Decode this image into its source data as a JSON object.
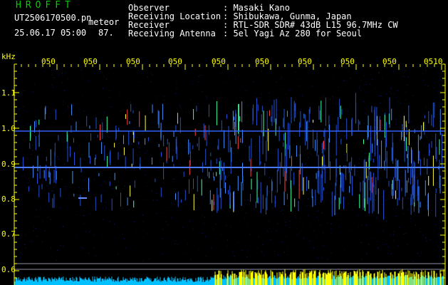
{
  "header": {
    "logo": "HROFFT",
    "filename": "UT2506170500.pn",
    "meteor_label": "meteor",
    "datetime": "25.06.17 05:00",
    "count": "87.",
    "fields": [
      {
        "label": "Observer",
        "value": ": Masaki Kano"
      },
      {
        "label": "Receiving Location",
        "value": ": Shibukawa, Gunma, Japan"
      },
      {
        "label": "Receiver",
        "value": ": RTL-SDR SDR# 43dB L15 96.7MHz CW"
      },
      {
        "label": "Receiving Antenna",
        "value": ": 5el Yagi Az 280 for Seoul"
      }
    ]
  },
  "axis": {
    "y_unit": "kHz",
    "y_ticks": [
      "1.1",
      "1.0",
      "0.9",
      "0.8",
      "0.7",
      "0.6"
    ],
    "x_ticks": [
      "050",
      "050",
      "050",
      "050",
      "050",
      "050",
      "050",
      "050",
      "050",
      "0510"
    ]
  },
  "colors": {
    "background": "#000000",
    "text": "#ffffff",
    "axis": "#ffff00",
    "logo": "#00d000",
    "carrier": "#3060ff",
    "meteor": "#40a0ff",
    "histogram_low": "#00c0ff",
    "histogram_high": "#ffff00"
  }
}
